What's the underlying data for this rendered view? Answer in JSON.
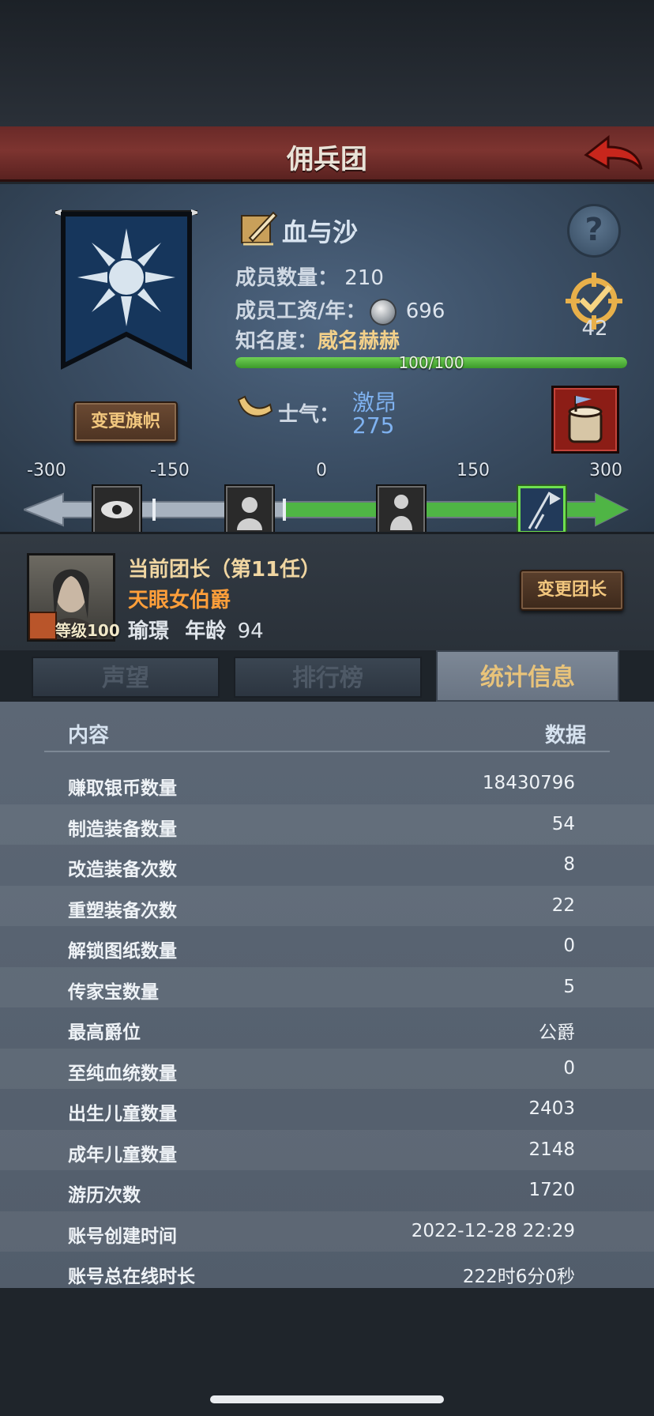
{
  "header": {
    "title": "佣兵团"
  },
  "guild": {
    "name": "血与沙",
    "members_label": "成员数量：",
    "members_value": "210",
    "salary_label": "成员工资/年：",
    "salary_value": "696",
    "fame_label": "知名度：",
    "fame_value": "威名赫赫",
    "fame_progress_text": "100/100",
    "fame_progress": 1.0,
    "badge_count": "42",
    "change_flag_label": "变更旗帜",
    "help_symbol": "?"
  },
  "morale": {
    "label": "士气：",
    "status": "激昂",
    "value": "275",
    "scale": [
      "-300",
      "-150",
      "0",
      "150",
      "300"
    ],
    "icons": [
      "eye-icon",
      "despair-icon",
      "calm-icon",
      "rally-icon"
    ]
  },
  "leader": {
    "title": "当前团长（第11任）",
    "name": "天眼女伯爵",
    "level_label": "等级100",
    "person": "瑜璟",
    "age_label": "年龄",
    "age_value": "94",
    "change_leader_label": "变更团长"
  },
  "tabs": [
    {
      "label": "声望"
    },
    {
      "label": "排行榜"
    },
    {
      "label": "统计信息"
    }
  ],
  "table": {
    "header_left": "内容",
    "header_right": "数据",
    "rows": [
      {
        "name": "赚取银币数量",
        "value": "18430796"
      },
      {
        "name": "制造装备数量",
        "value": "54"
      },
      {
        "name": "改造装备次数",
        "value": "8"
      },
      {
        "name": "重塑装备次数",
        "value": "22"
      },
      {
        "name": "解锁图纸数量",
        "value": "0"
      },
      {
        "name": "传家宝数量",
        "value": "5"
      },
      {
        "name": "最高爵位",
        "value": "公爵"
      },
      {
        "name": "至纯血统数量",
        "value": "0"
      },
      {
        "name": "出生儿童数量",
        "value": "2403"
      },
      {
        "name": "成年儿童数量",
        "value": "2148"
      },
      {
        "name": "游历次数",
        "value": "1720"
      },
      {
        "name": "账号创建时间",
        "value": "2022-12-28 22:29"
      },
      {
        "name": "账号总在线时长",
        "value": "222时6分0秒"
      }
    ]
  }
}
